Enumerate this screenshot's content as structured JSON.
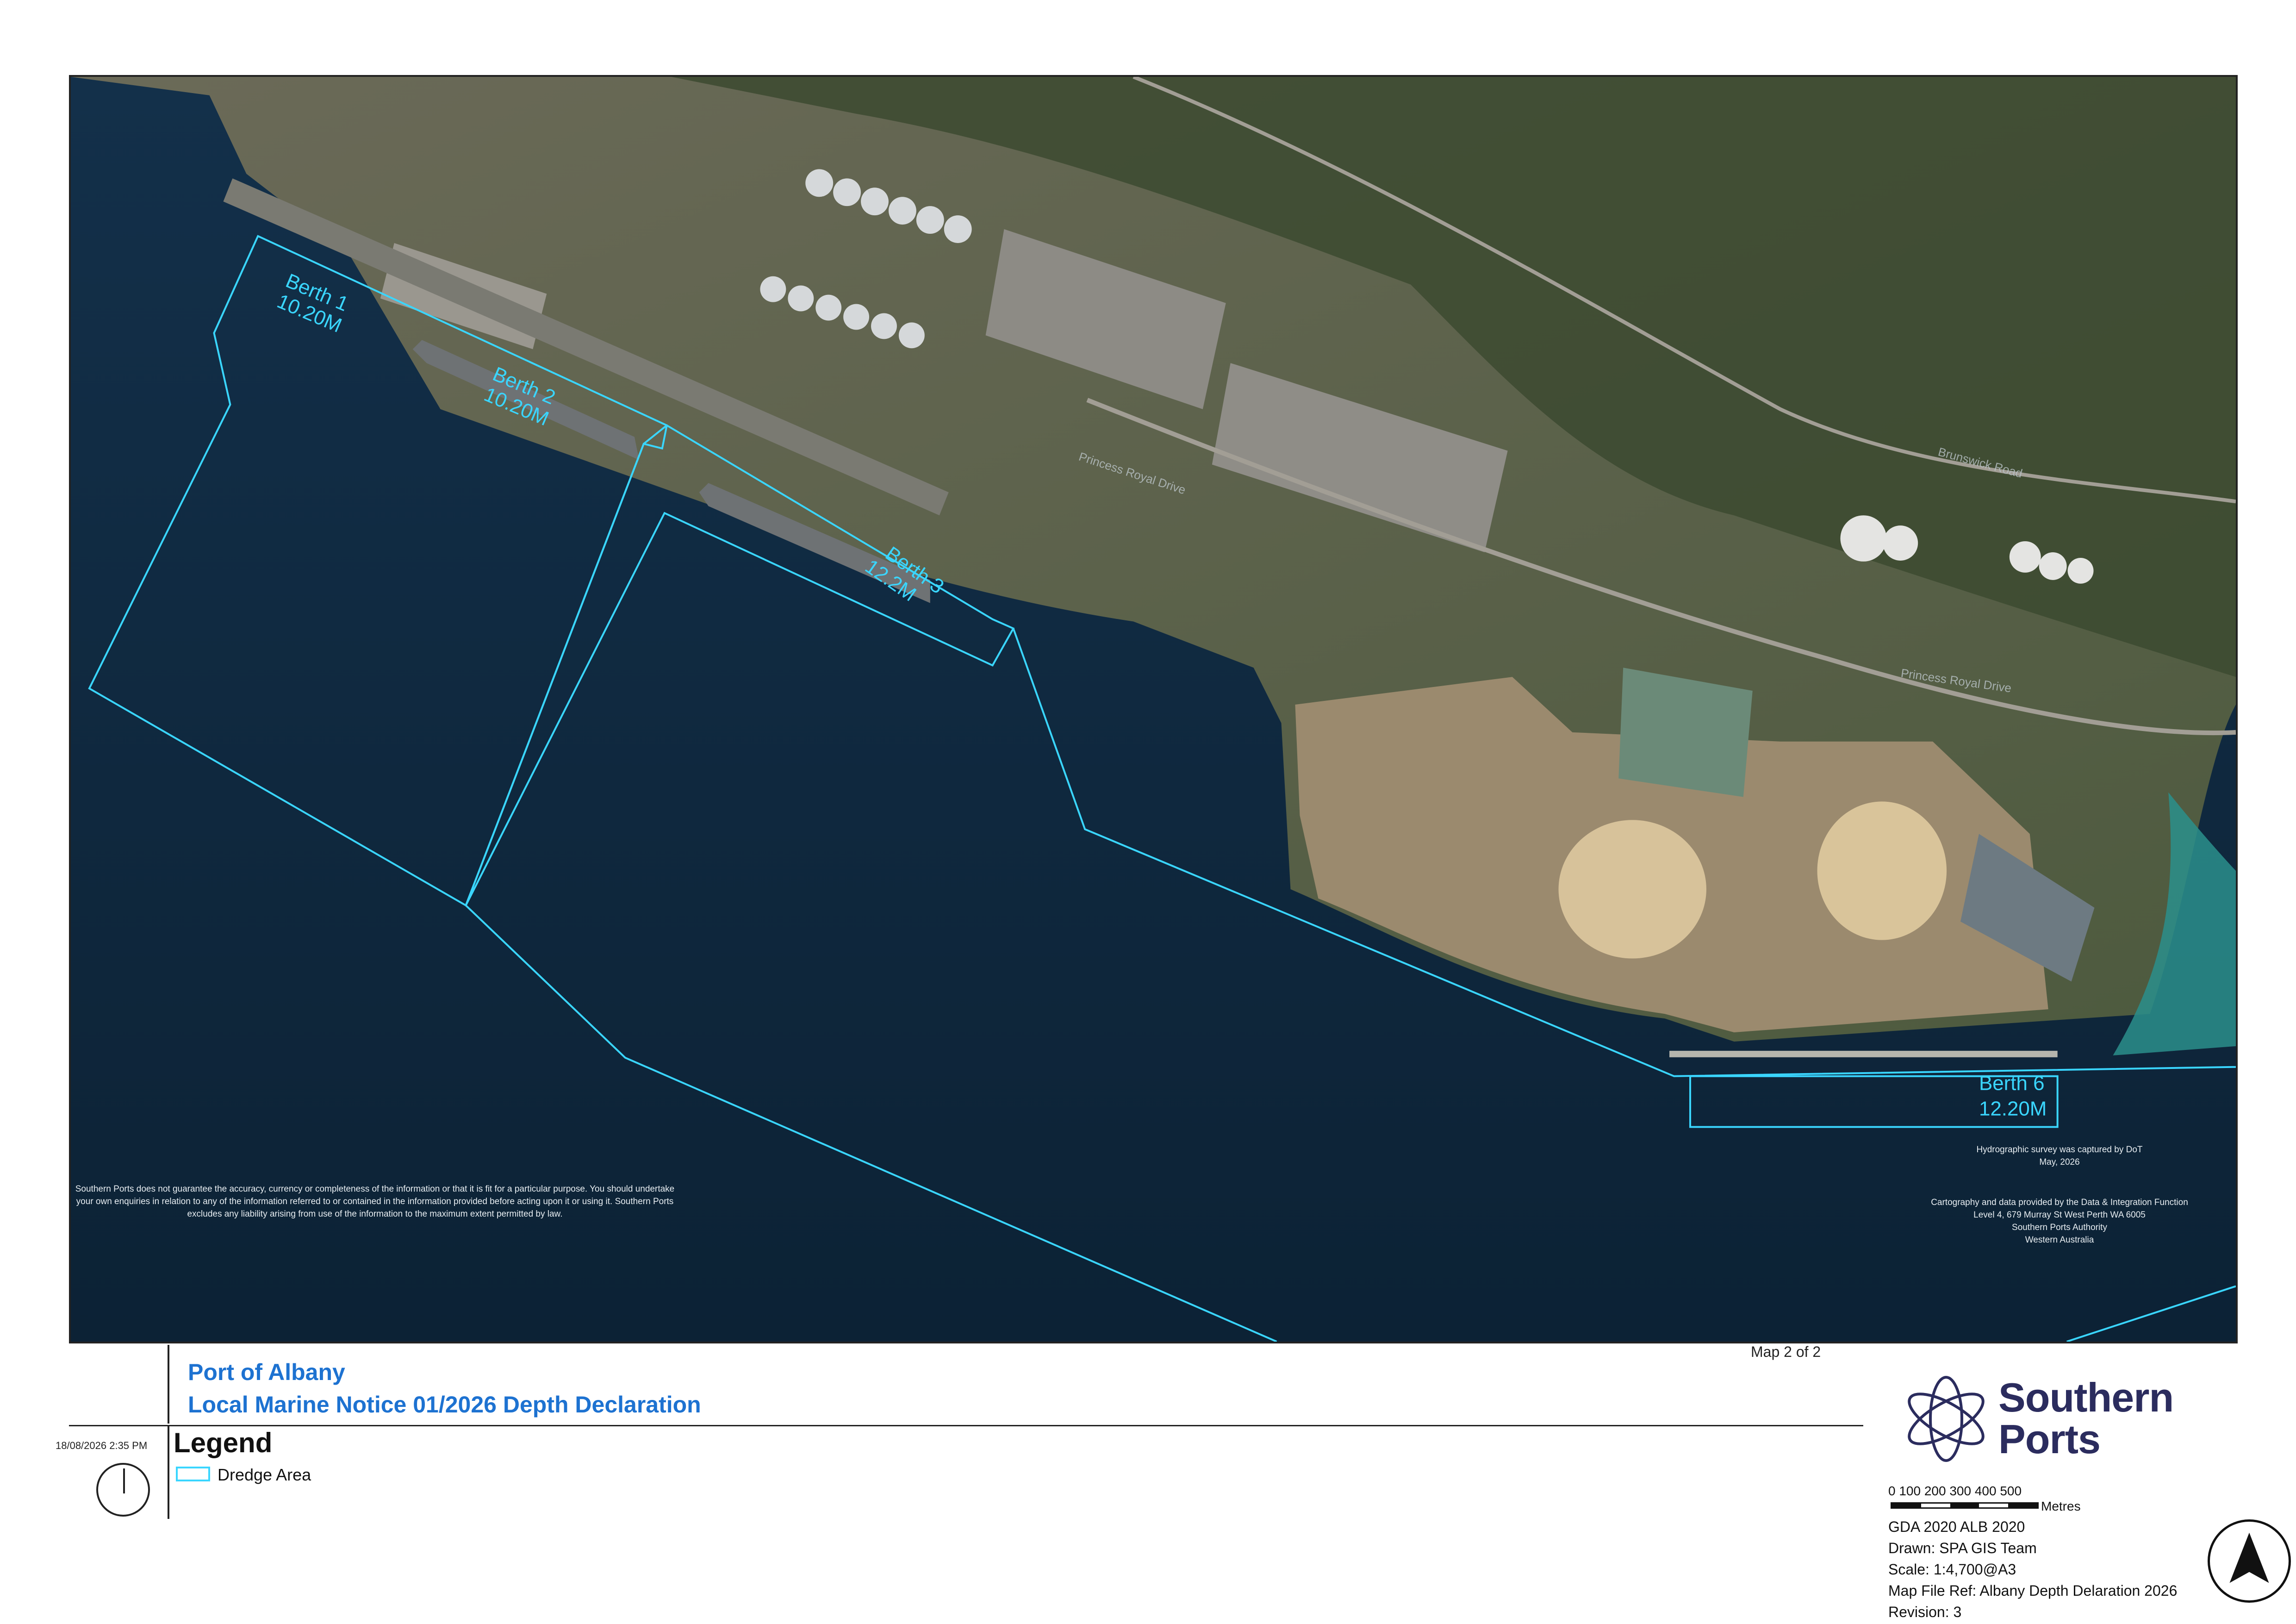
{
  "map": {
    "berths": [
      {
        "name": "Berth 1",
        "depth": "10.20M"
      },
      {
        "name": "Berth 2",
        "depth": "10.20M"
      },
      {
        "name": "Berth 3",
        "depth": "12.2M"
      },
      {
        "name": "Berth 6",
        "depth": "12.20M"
      }
    ],
    "road_labels": [
      "Princess Royal Drive",
      "Princess Royal Drive",
      "Brunswick Road"
    ],
    "dredge_color": "#3ad6ff",
    "disclaimer": "Southern Ports does not guarantee the accuracy, currency or completeness of the information or that it is fit for a particular purpose. You should undertake your own enquiries in relation to any of the information referred to or contained in the information provided before acting upon it or using it. Southern Ports excludes any liability arising from use of the information to the maximum extent permitted by law.",
    "survey_note": [
      "Hydrographic survey was captured by DoT",
      "May, 2026"
    ],
    "credits": [
      "Cartography and data provided by the Data & Integration Function",
      "Level 4, 679 Murray St West Perth WA 6005",
      "Southern Ports Authority",
      "Western Australia"
    ]
  },
  "title": {
    "line1": "Port of Albany",
    "line2": "Local Marine Notice 01/2026 Depth Declaration",
    "color": "#1d72d1",
    "map_of": "Map 2 of 2"
  },
  "date_stamp": "18/08/2026 2:35 PM",
  "legend": {
    "title": "Legend",
    "items": [
      {
        "label": "Dredge Area"
      }
    ]
  },
  "brand": {
    "line1": "Southern",
    "line2": "Ports",
    "color": "#2b2c5e"
  },
  "scale": {
    "ticks": "0    100  200  300  400  500",
    "unit": "Metres"
  },
  "info": {
    "datum": "GDA 2020 ALB 2020",
    "drawn": "Drawn: SPA GIS Team",
    "scale": "Scale: 1:4,700@A3",
    "file_ref": "Map File Ref:  Albany Depth Delaration 2026",
    "revision": "Revision: 3"
  }
}
